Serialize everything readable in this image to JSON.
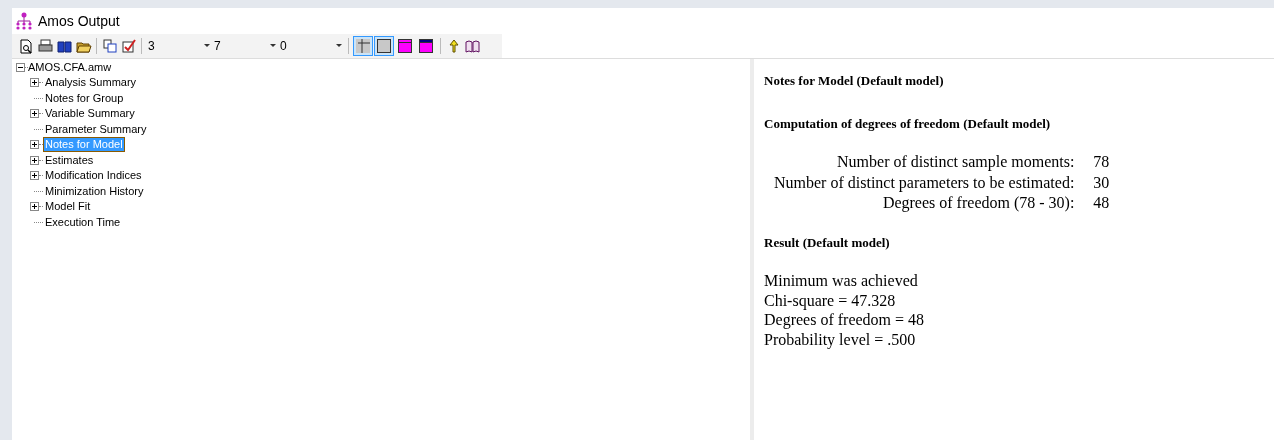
{
  "window": {
    "title": "Amos Output"
  },
  "toolbar": {
    "dropdowns": [
      {
        "value": "3"
      },
      {
        "value": "7"
      },
      {
        "value": "0"
      }
    ],
    "toggles": [
      {
        "kind": "grid",
        "pressed": true
      },
      {
        "kind": "plain",
        "pressed": true
      },
      {
        "kind": "magenta",
        "pressed": false
      },
      {
        "kind": "navy",
        "pressed": false
      }
    ]
  },
  "tree": {
    "label": "AMOS.CFA.amw",
    "expanded": true,
    "children": [
      {
        "label": "Analysis Summary",
        "kind": "branch",
        "selected": false
      },
      {
        "label": "Notes for Group",
        "kind": "leaf",
        "selected": false
      },
      {
        "label": "Variable Summary",
        "kind": "branch",
        "selected": false
      },
      {
        "label": "Parameter Summary",
        "kind": "leaf",
        "selected": false
      },
      {
        "label": "Notes for Model",
        "kind": "branch",
        "selected": true
      },
      {
        "label": "Estimates",
        "kind": "branch",
        "selected": false
      },
      {
        "label": "Modification Indices",
        "kind": "branch",
        "selected": false
      },
      {
        "label": "Minimization History",
        "kind": "leaf",
        "selected": false
      },
      {
        "label": "Model Fit",
        "kind": "branch",
        "selected": false
      },
      {
        "label": "Execution Time",
        "kind": "leaf",
        "selected": false
      }
    ]
  },
  "output": {
    "title": "Notes for Model (Default model)",
    "section": "Computation of degrees of freedom (Default model)",
    "rows": [
      {
        "label": "Number of distinct sample moments:",
        "value": "78"
      },
      {
        "label": "Number of distinct parameters to be estimated:",
        "value": "30"
      },
      {
        "label": "Degrees of freedom (78 - 30):",
        "value": "48"
      }
    ],
    "result_heading": "Result (Default model)",
    "result_lines": [
      "Minimum was achieved",
      "Chi-square = 47.328",
      "Degrees of freedom = 48",
      "Probability level = .500"
    ]
  }
}
